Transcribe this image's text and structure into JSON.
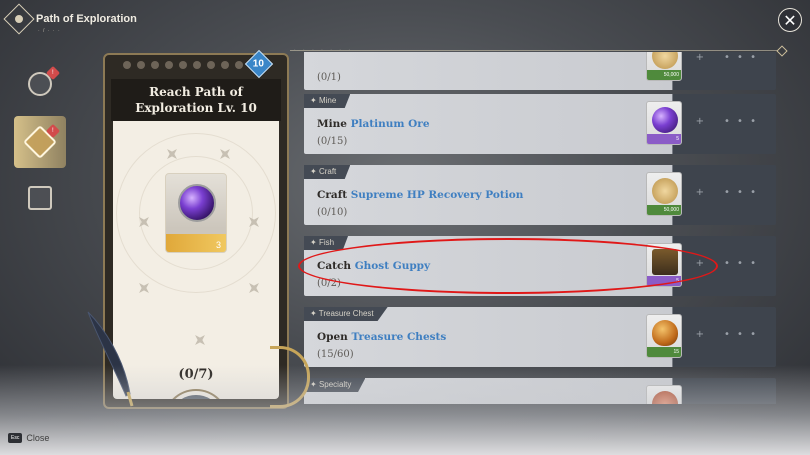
{
  "header": {
    "title": "Path of Exploration",
    "subtitle": "· / · · ·"
  },
  "close_icon": "close-icon",
  "nav": [
    {
      "icon": "map-icon",
      "badge": "!"
    },
    {
      "icon": "compass-icon",
      "badge": "!"
    },
    {
      "icon": "camp-icon",
      "badge": ""
    }
  ],
  "card": {
    "level": "10",
    "title": "Reach Path of Exploration Lv. 10",
    "reward_count": "3",
    "progress": "(0/7)",
    "more_label": "···"
  },
  "quests": [
    {
      "category": "",
      "action": "",
      "target": "",
      "progress": "(0/1)",
      "reward_count": "50,000",
      "reward_color": "#4f8a3c",
      "orb": "coin"
    },
    {
      "category": "Mine",
      "action": "Mine ",
      "target": "Platinum Ore",
      "progress": "(0/15)",
      "reward_count": "5",
      "reward_color": "#8b5cc7",
      "orb": "purple"
    },
    {
      "category": "Craft",
      "action": "Craft ",
      "target": "Supreme HP Recovery Potion",
      "progress": "(0/10)",
      "reward_count": "50,000",
      "reward_color": "#4f8a3c",
      "orb": "coin"
    },
    {
      "category": "Fish",
      "action": "Catch ",
      "target": "Ghost Guppy",
      "progress": "(0/2)",
      "reward_count": "5",
      "reward_color": "#8b5cc7",
      "orb": "chest"
    },
    {
      "category": "Treasure Chest",
      "action": "Open ",
      "target": "Treasure Chests",
      "progress": "(15/60)",
      "reward_count": "15",
      "reward_color": "#4f8a3c",
      "orb": "amber"
    },
    {
      "category": "Specialty",
      "action": "",
      "target": "",
      "progress": "",
      "reward_count": "",
      "reward_color": "#4f8a3c",
      "orb": "meat"
    }
  ],
  "footer": {
    "key": "Esc",
    "label": "Close"
  }
}
